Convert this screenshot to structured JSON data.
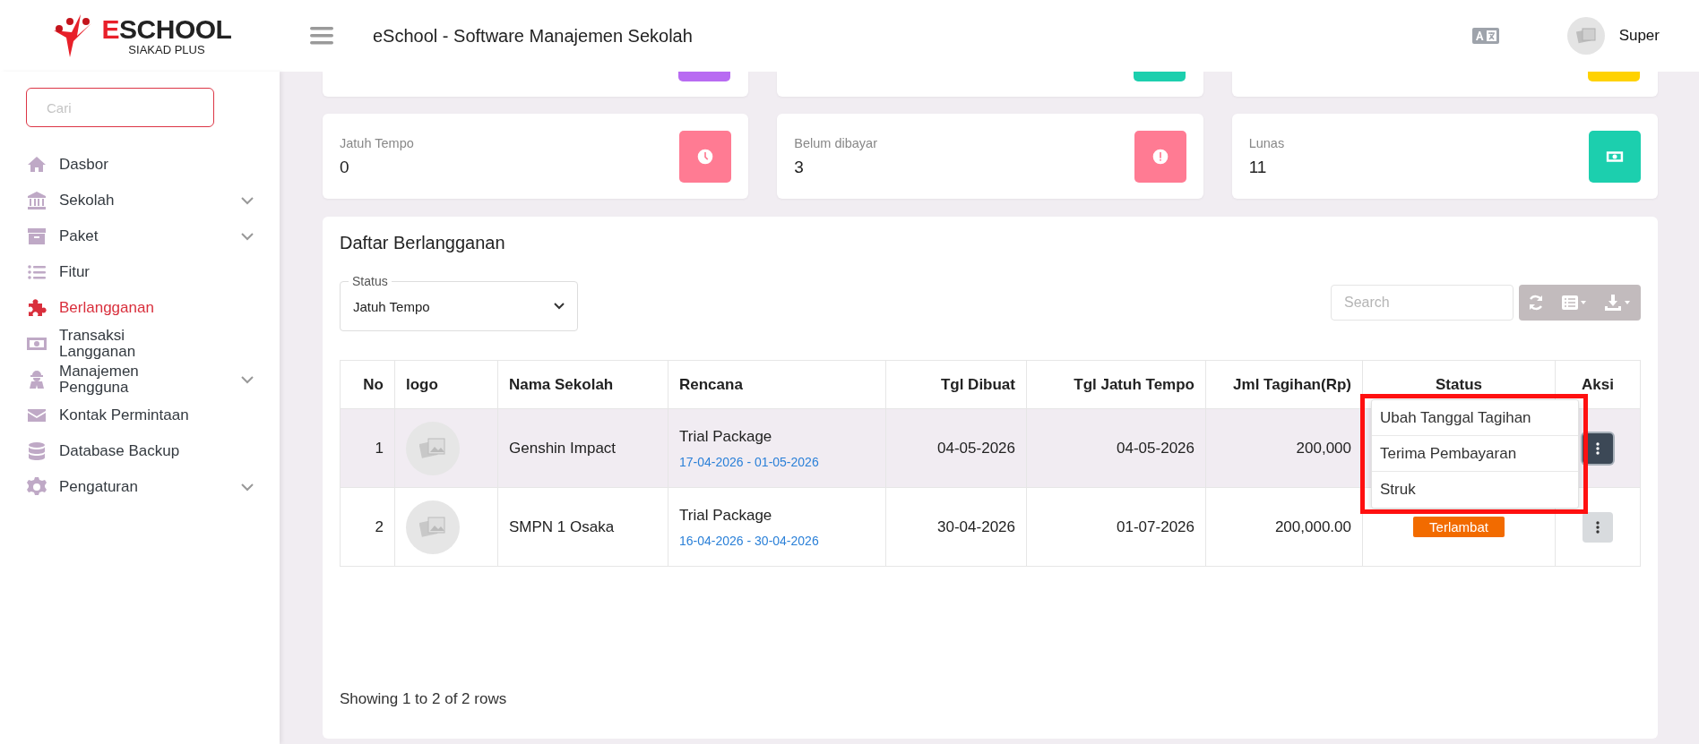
{
  "logo": {
    "accent": "E",
    "name": "SCHOOL",
    "tagline": "SIAKAD PLUS"
  },
  "header": {
    "title": "eSchool - Software Manajemen Sekolah",
    "user": "Super"
  },
  "sidebar": {
    "search": {
      "placeholder": "Cari"
    },
    "items": [
      {
        "label": "Dasbor",
        "expandable": false,
        "selected": false
      },
      {
        "label": "Sekolah",
        "expandable": true,
        "selected": false
      },
      {
        "label": "Paket",
        "expandable": true,
        "selected": false
      },
      {
        "label": "Fitur",
        "expandable": false,
        "selected": false
      },
      {
        "label": "Berlangganan",
        "expandable": false,
        "selected": true
      },
      {
        "label": "Transaksi Langganan",
        "expandable": false,
        "selected": false
      },
      {
        "label": "Manajemen Pengguna",
        "expandable": true,
        "selected": false
      },
      {
        "label": "Kontak Permintaan",
        "expandable": false,
        "selected": false
      },
      {
        "label": "Database Backup",
        "expandable": false,
        "selected": false
      },
      {
        "label": "Pengaturan",
        "expandable": true,
        "selected": false
      }
    ]
  },
  "top_cards": [
    {
      "color": "#b86bf2"
    },
    {
      "color": "#1ccfae"
    },
    {
      "color": "#ffd200"
    }
  ],
  "stat_cards": [
    {
      "label": "Jatuh Tempo",
      "value": "0",
      "color": "#ff7b93"
    },
    {
      "label": "Belum dibayar",
      "value": "3",
      "color": "#ff7b93"
    },
    {
      "label": "Lunas",
      "value": "11",
      "color": "#1ccfae"
    }
  ],
  "subscriptions": {
    "title": "Daftar Berlangganan",
    "status_filter": {
      "label": "Status",
      "value": "Jatuh Tempo"
    },
    "search": {
      "placeholder": "Search"
    },
    "table": {
      "columns": [
        "No",
        "logo",
        "Nama Sekolah",
        "Rencana",
        "Tgl Dibuat",
        "Tgl Jatuh Tempo",
        "Jml Tagihan(Rp)",
        "Status",
        "Aksi"
      ],
      "rows": [
        {
          "no": "1",
          "name": "Genshin Impact",
          "plan": "Trial Package",
          "period": "17-04-2026 - 01-05-2026",
          "created": "04-05-2026",
          "due": "04-05-2026",
          "amount": "200,000",
          "selected": true,
          "menu_open": true
        },
        {
          "no": "2",
          "name": "SMPN 1 Osaka",
          "plan": "Trial Package",
          "period": "16-04-2026 - 30-04-2026",
          "created": "30-04-2026",
          "due": "01-07-2026",
          "amount": "200,000.00",
          "status": {
            "label": "Terlambat",
            "kind": "late"
          },
          "selected": false,
          "menu_open": false
        }
      ],
      "action_menu": [
        "Ubah Tanggal Tagihan",
        "Terima Pembayaran",
        "Struk"
      ]
    },
    "annotation": {
      "kind": "frame"
    },
    "footer": "Showing 1 to 2 of 2 rows"
  }
}
